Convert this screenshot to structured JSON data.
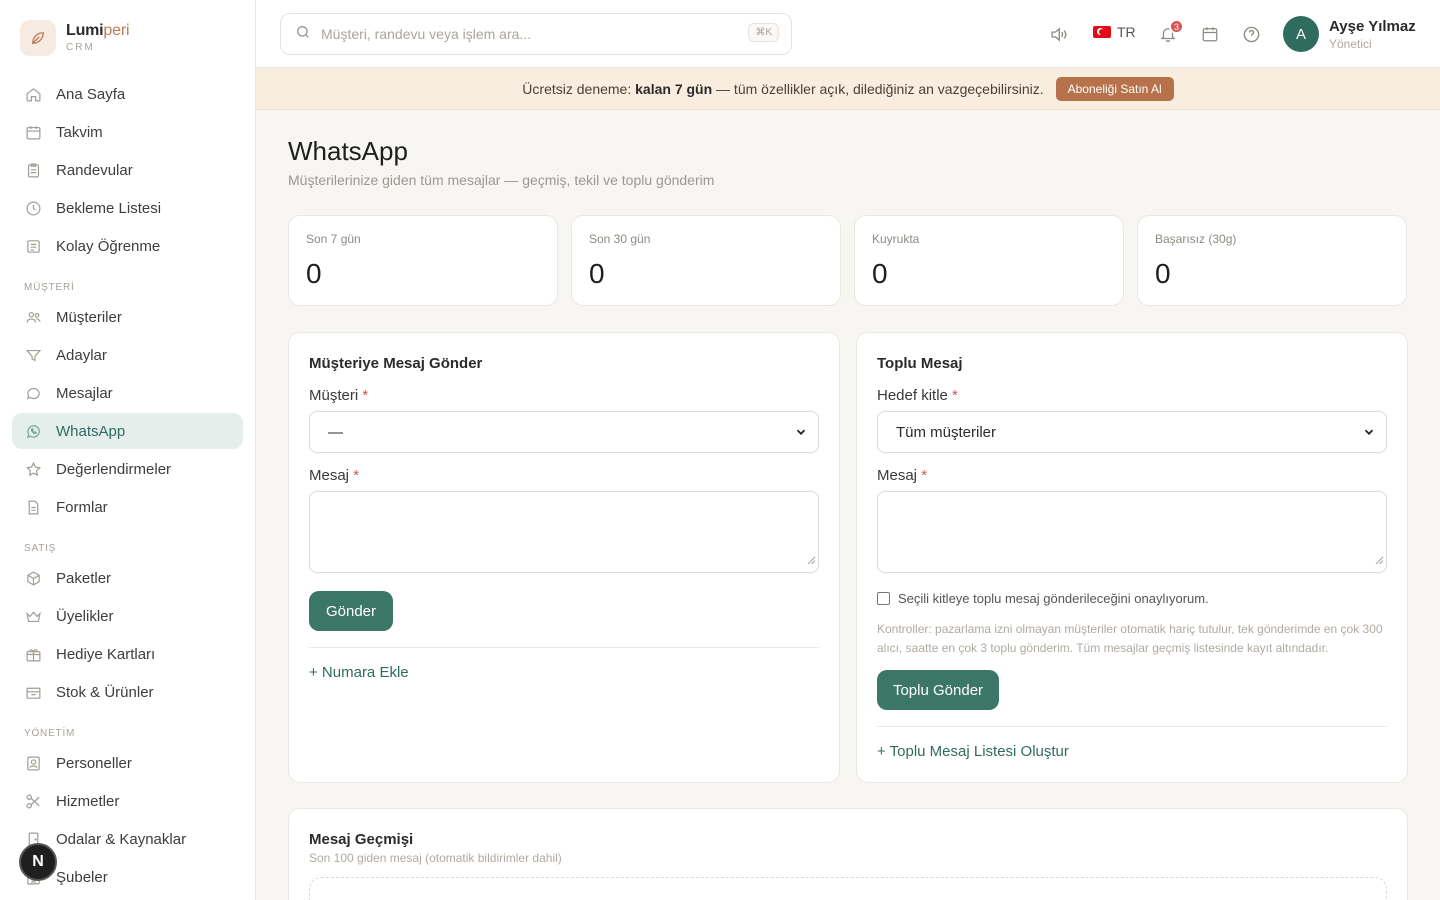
{
  "brand": {
    "name_main": "Lumi",
    "name_accent": "peri",
    "sub": "CRM"
  },
  "sidebar": {
    "main_items": [
      {
        "label": "Ana Sayfa",
        "icon": "home-icon"
      },
      {
        "label": "Takvim",
        "icon": "calendar-icon"
      },
      {
        "label": "Randevular",
        "icon": "clipboard-icon"
      },
      {
        "label": "Bekleme Listesi",
        "icon": "clock-icon"
      },
      {
        "label": "Kolay Öğrenme",
        "icon": "book-icon"
      }
    ],
    "sections": {
      "customer": "MÜŞTERİ",
      "sales": "SATIŞ",
      "management": "YÖNETİM"
    },
    "customer_items": [
      {
        "label": "Müşteriler",
        "icon": "users-icon"
      },
      {
        "label": "Adaylar",
        "icon": "filter-icon"
      },
      {
        "label": "Mesajlar",
        "icon": "chat-icon"
      },
      {
        "label": "WhatsApp",
        "icon": "whatsapp-icon",
        "active": true
      },
      {
        "label": "Değerlendirmeler",
        "icon": "star-icon"
      },
      {
        "label": "Formlar",
        "icon": "document-icon"
      }
    ],
    "sales_items": [
      {
        "label": "Paketler",
        "icon": "package-icon"
      },
      {
        "label": "Üyelikler",
        "icon": "crown-icon"
      },
      {
        "label": "Hediye Kartları",
        "icon": "gift-card-icon"
      },
      {
        "label": "Stok & Ürünler",
        "icon": "box-icon"
      }
    ],
    "management_items": [
      {
        "label": "Personeller",
        "icon": "badge-icon"
      },
      {
        "label": "Hizmetler",
        "icon": "scissors-icon"
      },
      {
        "label": "Odalar & Kaynaklar",
        "icon": "door-icon"
      },
      {
        "label": "Şubeler",
        "icon": "building-icon"
      }
    ],
    "floating_badge": "N"
  },
  "topbar": {
    "search_placeholder": "Müşteri, randevu veya işlem ara...",
    "search_shortcut": "⌘K",
    "language": "TR",
    "notification_count": "3",
    "user": {
      "initial": "A",
      "name": "Ayşe Yılmaz",
      "role": "Yönetici"
    }
  },
  "banner": {
    "prefix": "Ücretsiz deneme: ",
    "bold": "kalan 7 gün",
    "suffix": " — tüm özellikler açık, dilediğiniz an vazgeçebilirsiniz.",
    "button": "Aboneliği Satın Al"
  },
  "page": {
    "title": "WhatsApp",
    "subtitle": "Müşterilerinize giden tüm mesajlar — geçmiş, tekil ve toplu gönderim"
  },
  "stats": [
    {
      "label": "Son 7 gün",
      "value": "0"
    },
    {
      "label": "Son 30 gün",
      "value": "0"
    },
    {
      "label": "Kuyrukta",
      "value": "0"
    },
    {
      "label": "Başarısız (30g)",
      "value": "0"
    }
  ],
  "single_message": {
    "title": "Müşteriye Mesaj Gönder",
    "customer_label": "Müşteri",
    "customer_value": "—",
    "message_label": "Mesaj",
    "required_mark": "*",
    "send_button": "Gönder",
    "add_number_link": "+ Numara Ekle"
  },
  "bulk_message": {
    "title": "Toplu Mesaj",
    "audience_label": "Hedef kitle",
    "audience_value": "Tüm müşteriler",
    "message_label": "Mesaj",
    "required_mark": "*",
    "confirm_text": "Seçili kitleye toplu mesaj gönderileceğini onaylıyorum.",
    "note": "Kontroller: pazarlama izni olmayan müşteriler otomatik hariç tutulur, tek gönderimde en çok 300 alıcı, saatte en çok 3 toplu gönderim. Tüm mesajlar geçmiş listesinde kayıt altındadır.",
    "send_button": "Toplu Gönder",
    "create_list_link": "+ Toplu Mesaj Listesi Oluştur"
  },
  "history": {
    "title": "Mesaj Geçmişi",
    "subtitle": "Son 100 giden mesaj (otomatik bildirimler dahil)"
  },
  "colors": {
    "primary": "#3b7667",
    "accent": "#b7714b",
    "active_bg": "#e4efec",
    "banner_bg": "#f8eddf"
  }
}
